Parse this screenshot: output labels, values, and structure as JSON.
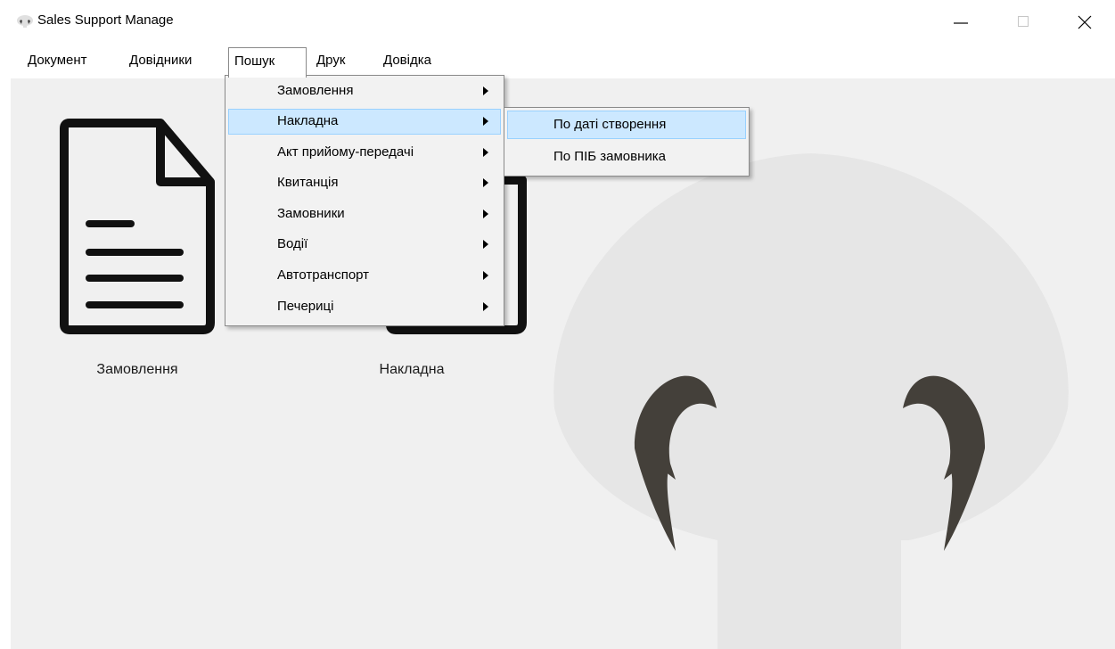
{
  "window": {
    "title": "Sales Support Manage",
    "icon": "mushroom-app-icon"
  },
  "menubar": {
    "items": [
      {
        "label": "Документ"
      },
      {
        "label": "Довідники"
      },
      {
        "label": "Пошук",
        "open": true
      },
      {
        "label": "Друк"
      },
      {
        "label": "Довідка"
      }
    ]
  },
  "search_menu": {
    "items": [
      {
        "label": "Замовлення",
        "has_submenu": true
      },
      {
        "label": "Накладна",
        "has_submenu": true,
        "highlighted": true
      },
      {
        "label": "Акт прийому-передачі",
        "has_submenu": true
      },
      {
        "label": "Квитанція",
        "has_submenu": true
      },
      {
        "label": "Замовники",
        "has_submenu": true
      },
      {
        "label": "Водії",
        "has_submenu": true
      },
      {
        "label": "Автотранспорт",
        "has_submenu": true
      },
      {
        "label": "Печериці",
        "has_submenu": true
      }
    ]
  },
  "invoice_submenu": {
    "items": [
      {
        "label": "По даті створення",
        "highlighted": true
      },
      {
        "label": "По ПІБ замовника"
      }
    ]
  },
  "tiles": [
    {
      "label": "Замовлення",
      "icon": "document-icon"
    },
    {
      "label": "Накладна",
      "icon": "document-icon"
    }
  ],
  "colors": {
    "highlight": "#cce8ff",
    "highlight_border": "#99d1ff",
    "menu_bg": "#f2f2f2",
    "client_bg": "#f0f0f0",
    "mushroom_cap": "#e6e6e6",
    "mushroom_gills": "#44403a"
  }
}
